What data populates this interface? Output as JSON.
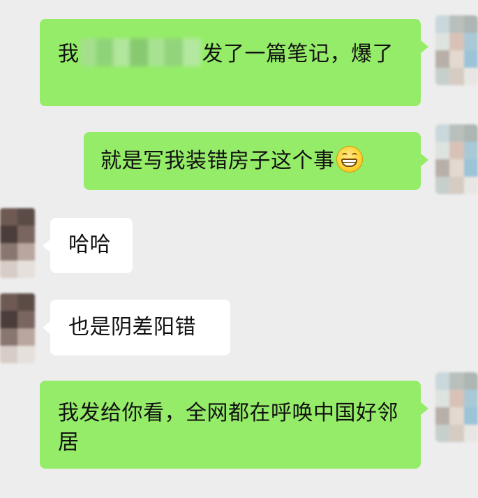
{
  "messages": [
    {
      "direction": "out",
      "text_before": "我",
      "text_after": "发了一篇笔记，爆了",
      "redacted": true
    },
    {
      "direction": "out",
      "text": "就是写我装错房子这个事",
      "emoji": "grinning-face-emoji"
    },
    {
      "direction": "in",
      "text": "哈哈"
    },
    {
      "direction": "in",
      "text": "也是阴差阳错"
    },
    {
      "direction": "out",
      "text": "我发给你看，全网都在呼唤中国好邻居"
    }
  ],
  "colors": {
    "background": "#ededed",
    "outgoing_bubble": "#95ec69",
    "incoming_bubble": "#ffffff",
    "text": "#111111"
  },
  "avatars": {
    "right_palette": [
      "#c8d8dc",
      "#b9c0bc",
      "#aeb6b4",
      "#dde3df",
      "#d8c2b8",
      "#a9c9d6",
      "#b8b0a8",
      "#e3d9d0",
      "#9cc4d9",
      "#c7cfcc",
      "#d6ccc4",
      "#e8e6e2"
    ],
    "left_palette": [
      "#6e5a53",
      "#5c4c47",
      "#4a3d3a",
      "#7a6560",
      "#8a7670",
      "#b9a69e",
      "#d8ccc6",
      "#e6e0dc"
    ]
  }
}
